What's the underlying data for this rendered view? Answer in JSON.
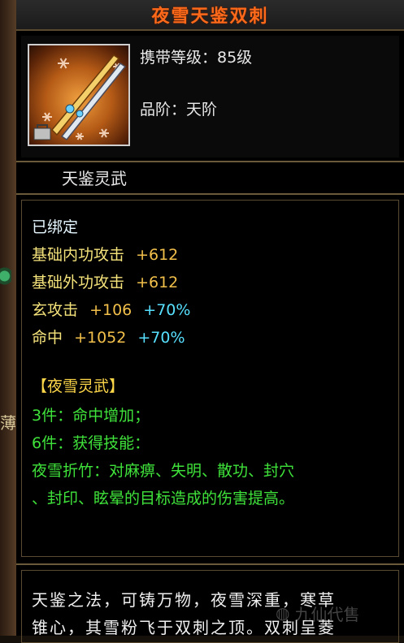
{
  "item": {
    "name": "夜雪天鉴双刺",
    "carry_level": "携带等级：85级",
    "grade": "品阶：天阶",
    "category": "天鉴灵武"
  },
  "stats": {
    "bound": "已绑定",
    "inner_attack": {
      "label": "基础内功攻击",
      "value": "+612"
    },
    "outer_attack": {
      "label": "基础外功攻击",
      "value": "+612"
    },
    "mystic_attack": {
      "label": "玄攻击",
      "value": "+106",
      "bonus": "+70%"
    },
    "hit": {
      "label": "命中",
      "value": "+1052",
      "bonus": "+70%"
    }
  },
  "set": {
    "title": "【夜雪灵武】",
    "piece3": "3件：命中增加；",
    "piece6": "6件：获得技能：",
    "skill_line1": "夜雪折竹：对麻痹、失明、散功、封穴",
    "skill_line2": "、封印、眩晕的目标造成的伤害提高。"
  },
  "description": {
    "line1": "天鉴之法，可铸万物，夜雪深重，寒草",
    "line2": "锥心，其雪粉飞于双刺之顶。双刺呈菱"
  },
  "background": {
    "left_char": "薄",
    "watermark": "九仙代售"
  },
  "colors": {
    "title": "#ff6a1a",
    "stat_yellow": "#f4e27a",
    "bonus_cyan": "#57e0ff",
    "set_green": "#3fe23a",
    "set_title_gold": "#ffd84a"
  }
}
